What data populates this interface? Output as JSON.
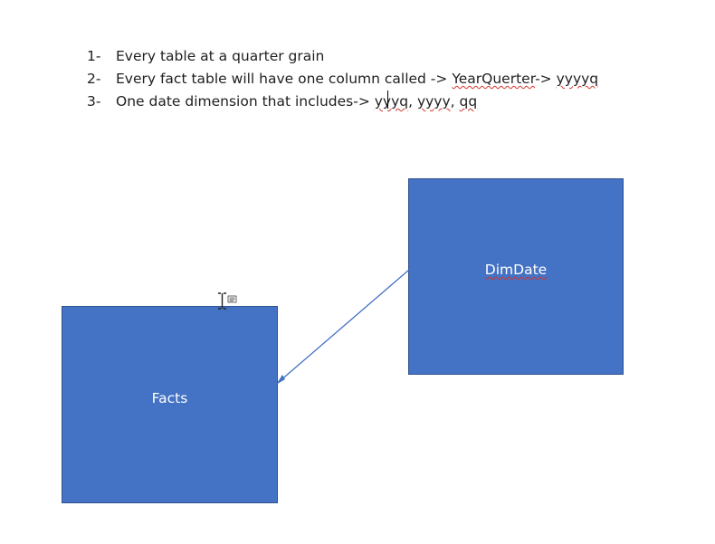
{
  "notes": [
    {
      "number": "1-",
      "text": "Every table at a quarter grain"
    },
    {
      "number": "2-",
      "text_before": "Every fact table will have one column called -> ",
      "term1": "YearQuerter",
      "text_mid": "-> ",
      "term2": "yyyyq"
    },
    {
      "number": "3-",
      "text_before": "One date dimension that includes-> ",
      "term1": "yyyq",
      "sep1": ", ",
      "term2": "yyyy",
      "sep2": ", ",
      "term3": "qq"
    }
  ],
  "diagram": {
    "facts_label": "Facts",
    "dimdate_label": "DimDate",
    "box_color": "#4472c4",
    "line_color": "#4472c4"
  },
  "icons": {
    "cursor": "text-cursor-icon"
  }
}
